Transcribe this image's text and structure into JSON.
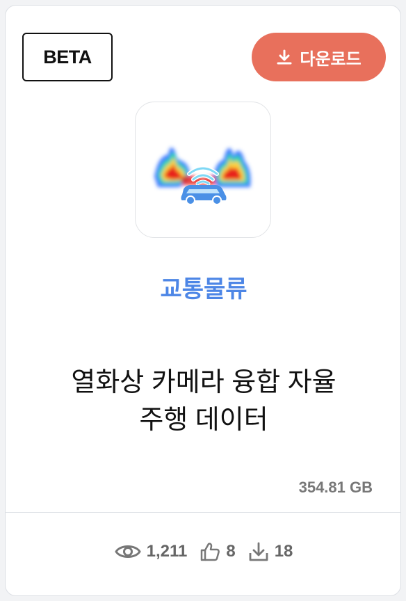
{
  "badge": {
    "label": "BETA"
  },
  "download_button": {
    "label": "다운로드",
    "color": "#e8705c"
  },
  "thumbnail": {
    "icon": "thermal-camera-car-icon"
  },
  "category": {
    "label": "교통물류",
    "color": "#4d86e6"
  },
  "dataset": {
    "title_line1": "열화상 카메라 융합 자율",
    "title_line2": "주행 데이터",
    "size": "354.81 GB"
  },
  "stats": {
    "views": "1,211",
    "likes": "8",
    "downloads": "18"
  }
}
